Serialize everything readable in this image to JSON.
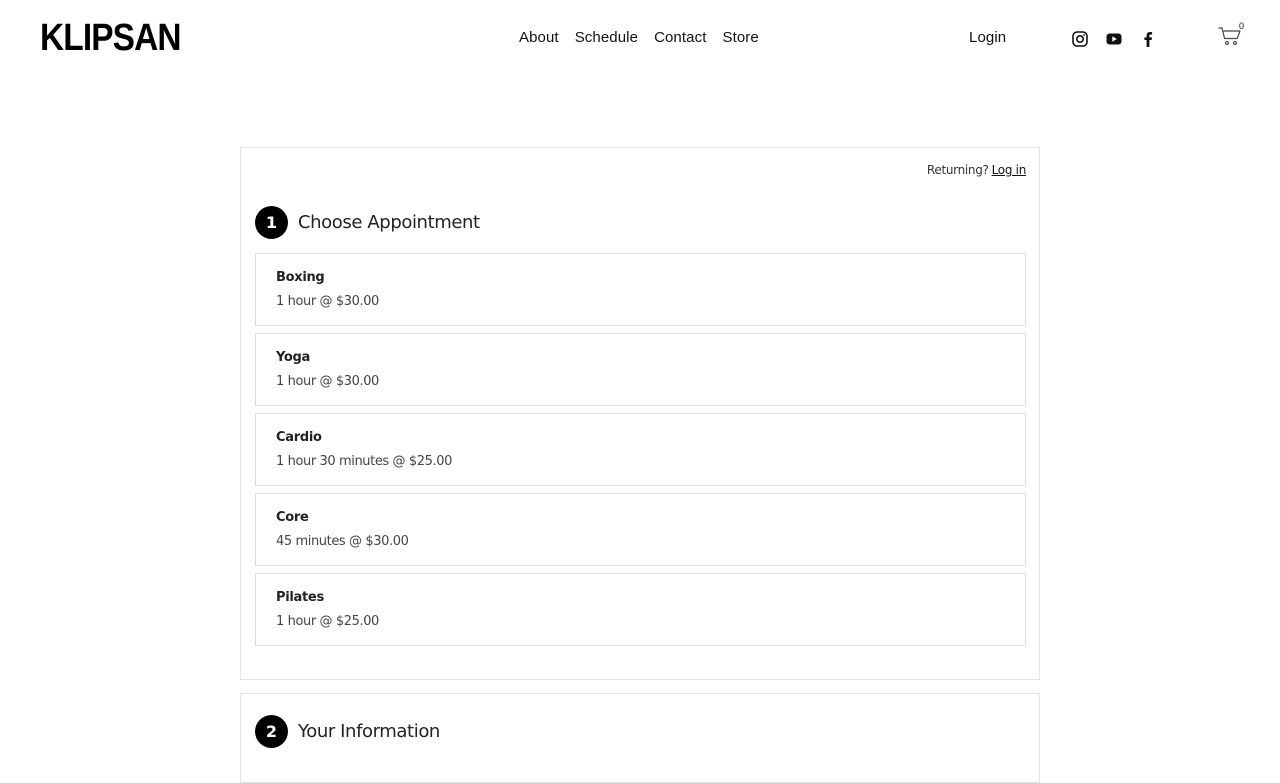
{
  "header": {
    "logo": "KLIPSAN",
    "nav": [
      "About",
      "Schedule",
      "Contact",
      "Store"
    ],
    "login": "Login",
    "social_icons": [
      "instagram-icon",
      "youtube-icon",
      "facebook-icon"
    ],
    "cart_count": "0"
  },
  "scheduler": {
    "returning_label": "Returning?",
    "login_link": "Log in",
    "step1": {
      "number": "1",
      "title": "Choose Appointment"
    },
    "appointments": [
      {
        "name": "Boxing",
        "detail": "1 hour @ $30.00"
      },
      {
        "name": "Yoga",
        "detail": "1 hour @ $30.00"
      },
      {
        "name": "Cardio",
        "detail": "1 hour 30 minutes @ $25.00"
      },
      {
        "name": "Core",
        "detail": "45 minutes @ $30.00"
      },
      {
        "name": "Pilates",
        "detail": "1 hour @ $25.00"
      }
    ],
    "step2": {
      "number": "2",
      "title": "Your Information"
    }
  }
}
